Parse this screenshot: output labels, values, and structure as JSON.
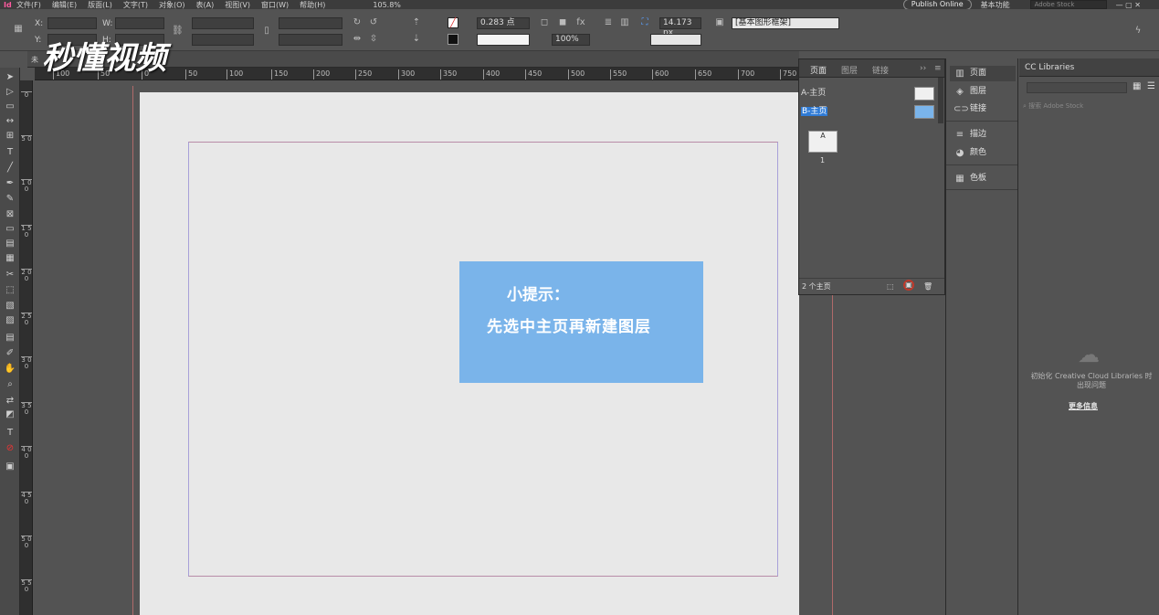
{
  "menubar": {
    "logo": "Id",
    "items": [
      "文件(F)",
      "编辑(E)",
      "版面(L)",
      "文字(T)",
      "对象(O)",
      "表(A)",
      "视图(V)",
      "窗口(W)",
      "帮助(H)"
    ],
    "zoom": "105.8%",
    "publish_label": "Publish Online",
    "workspace": "基本功能",
    "search_placeholder": "Adobe Stock"
  },
  "controlbar": {
    "x_label": "X:",
    "y_label": "Y:",
    "w_label": "W:",
    "h_label": "H:",
    "stroke_weight": "0.283 点",
    "opacity": "100%",
    "size_px": "14.173 px",
    "style_dropdown": "[基本图形框架]"
  },
  "doctab": {
    "title": "未"
  },
  "watermark": "秒懂视频",
  "ruler": {
    "h_ticks": [
      "100",
      "50",
      "0",
      "50",
      "100",
      "150",
      "200",
      "250",
      "300",
      "350",
      "400",
      "450",
      "500",
      "550",
      "600",
      "650",
      "700",
      "750"
    ],
    "v_ticks": [
      "0",
      "5 0",
      "1 0 0",
      "1 5 0",
      "2 0 0",
      "2 5 0",
      "3 0 0",
      "3 5 0",
      "4 0 0",
      "4 5 0",
      "5 0 0",
      "5 5 0"
    ]
  },
  "tip": {
    "line1": "小提示：",
    "line2": "先选中主页再新建图层"
  },
  "pages_panel": {
    "tabs": [
      "页面",
      "图层",
      "链接"
    ],
    "masters": [
      "A-主页",
      "B-主页"
    ],
    "page_letter": "A",
    "page_number": "1",
    "footer": "2 个主页"
  },
  "dock": {
    "items": [
      "页面",
      "图层",
      "链接",
      "描边",
      "颜色",
      "色板"
    ],
    "icons": [
      "pages-icon",
      "layers-icon",
      "links-icon",
      "stroke-icon",
      "color-icon",
      "swatches-icon"
    ]
  },
  "cc_libraries": {
    "title": "CC Libraries",
    "search_placeholder": "搜索 Adobe Stock",
    "message": "初始化 Creative Cloud Libraries 时出现问题",
    "more_info": "更多信息"
  }
}
